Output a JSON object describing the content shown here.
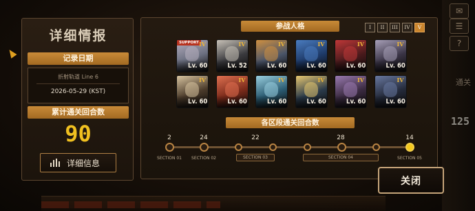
{
  "left": {
    "title": "详细情报",
    "record_date_label": "记录日期",
    "track_name": "折射轨道 Line 6",
    "date_value": "2026-05-29 (KST)",
    "total_rounds_label": "累计通关回合数",
    "total_rounds": "90",
    "detail_button": "详细信息"
  },
  "right": {
    "personas_header": "参战人格",
    "tiers": [
      "I",
      "II",
      "III",
      "IV",
      "V"
    ],
    "active_tier": "V",
    "sections_header": "各区段通关回合数"
  },
  "support_tag": "SUPPORT",
  "cards": [
    {
      "rank": "IV",
      "level": "Lv. 60",
      "support": true,
      "color": "#6b6f80",
      "accent": "#b8b0c0"
    },
    {
      "rank": "IV",
      "level": "Lv. 52",
      "support": false,
      "color": "#3a3a3e",
      "accent": "#c8c2b8"
    },
    {
      "rank": "IV",
      "level": "Lv. 60",
      "support": false,
      "color": "#4a5468",
      "accent": "#d09040"
    },
    {
      "rank": "IV",
      "level": "Lv. 60",
      "support": false,
      "color": "#1e3a68",
      "accent": "#4a7cc0"
    },
    {
      "rank": "IV",
      "level": "Lv. 60",
      "support": false,
      "color": "#4a1a1c",
      "accent": "#c03838"
    },
    {
      "rank": "IV",
      "level": "Lv. 60",
      "support": false,
      "color": "#3a3446",
      "accent": "#a8a0b8"
    },
    {
      "rank": "IV",
      "level": "Lv. 60",
      "support": false,
      "color": "#4a3a2a",
      "accent": "#d8c4a0"
    },
    {
      "rank": "IV",
      "level": "Lv. 60",
      "support": false,
      "color": "#7a2a1a",
      "accent": "#e07050"
    },
    {
      "rank": "IV",
      "level": "Lv. 60",
      "support": false,
      "color": "#2a5a70",
      "accent": "#9ad0e0"
    },
    {
      "rank": "IV",
      "level": "Lv. 60",
      "support": false,
      "color": "#2a3a4a",
      "accent": "#e8c870"
    },
    {
      "rank": "IV",
      "level": "Lv. 60",
      "support": false,
      "color": "#3a2a40",
      "accent": "#9a7ab0"
    },
    {
      "rank": "IV",
      "level": "Lv. 60",
      "support": false,
      "color": "#242a3a",
      "accent": "#6878a0"
    }
  ],
  "sections": [
    {
      "label": "SECTION 01",
      "rounds": "2"
    },
    {
      "label": "SECTION 02",
      "rounds": "24"
    },
    {
      "label": "SECTION 03",
      "rounds": "22"
    },
    {
      "label": "SECTION 04",
      "rounds": "28"
    },
    {
      "label": "SECTION 05",
      "rounds": "14"
    }
  ],
  "close_button": "关闭",
  "side": {
    "count": "125",
    "faded_text": "通关"
  }
}
